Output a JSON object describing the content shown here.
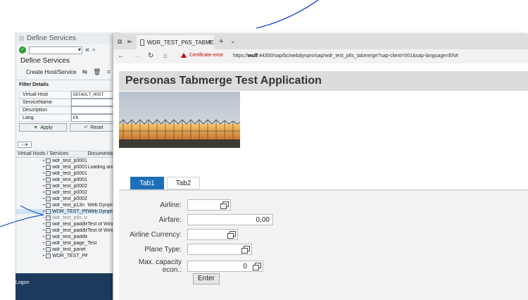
{
  "sap_window": {
    "title": "Define Services",
    "heading": "Define Services",
    "create_host_label": "Create Host/Service",
    "filter_title": "Filter Details",
    "filters": [
      {
        "label": "Virtual Host",
        "value": "DEFAULT_HOST"
      },
      {
        "label": "ServiceName",
        "value": ""
      },
      {
        "label": "Description",
        "value": ""
      },
      {
        "label": "Lang.",
        "value": "EN"
      }
    ],
    "apply_label": "Apply",
    "reset_label": "Reset",
    "tree_headers": [
      "Virtual Hosts / Services",
      "Documentati"
    ],
    "tree_rows": [
      {
        "name": "wdr_test_p0001",
        "desc": ""
      },
      {
        "name": "wdr_test_p0001",
        "desc": "Loading and"
      },
      {
        "name": "wdr_test_p0001",
        "desc": ""
      },
      {
        "name": "wdr_test_p0001",
        "desc": ""
      },
      {
        "name": "wdr_test_p0002",
        "desc": ""
      },
      {
        "name": "wdr_test_p0002",
        "desc": ""
      },
      {
        "name": "wdr_test_p0002",
        "desc": ""
      },
      {
        "name": "wdr_test_p13n",
        "desc": "Web Dynpro"
      },
      {
        "name": "WDR_TEST_P6S",
        "desc": "Web Dynpro"
      },
      {
        "name": "wdr_test_p6s_ta",
        "desc": ""
      },
      {
        "name": "wdr_test_paddle",
        "desc": "Test of Wind"
      },
      {
        "name": "wdr_test_paddle",
        "desc": "Test of Wind"
      },
      {
        "name": "wdr_test_paddle",
        "desc": ""
      },
      {
        "name": "wdr_test_page_c",
        "desc": "Test"
      },
      {
        "name": "wdr_test_panel",
        "desc": ""
      },
      {
        "name": "WDR_TEST_PAN",
        "desc": ""
      }
    ],
    "taskbar_text": "Logon"
  },
  "browser": {
    "tab_title": "WDR_TEST_P6S_TABME",
    "cert_error": "Certificate error",
    "url_prefix": "https://",
    "url_host": "wulf",
    "url_rest": ":44300/sap/bc/webdynpro/sap/wdr_test_p6s_tabmerge?sap-client=001&sap-language=EN#"
  },
  "app": {
    "title": "Personas Tabmerge Test Application",
    "tabs": [
      "Tab1",
      "Tab2"
    ],
    "fields": [
      {
        "label": "Airline:",
        "value": ""
      },
      {
        "label": "Airfare:",
        "value": "0,00"
      },
      {
        "label": "Airline Currency:",
        "value": ""
      },
      {
        "label": "Plane Type:",
        "value": ""
      },
      {
        "label": "Max. capacity econ.:",
        "value": "0"
      }
    ],
    "enter_label": "Enter"
  },
  "colors": {
    "active_tab": "#1d6fb8",
    "cert_error": "#cc0000",
    "ok_icon": "#2e9a2e",
    "ink_annotation": "#1f4fd1"
  }
}
